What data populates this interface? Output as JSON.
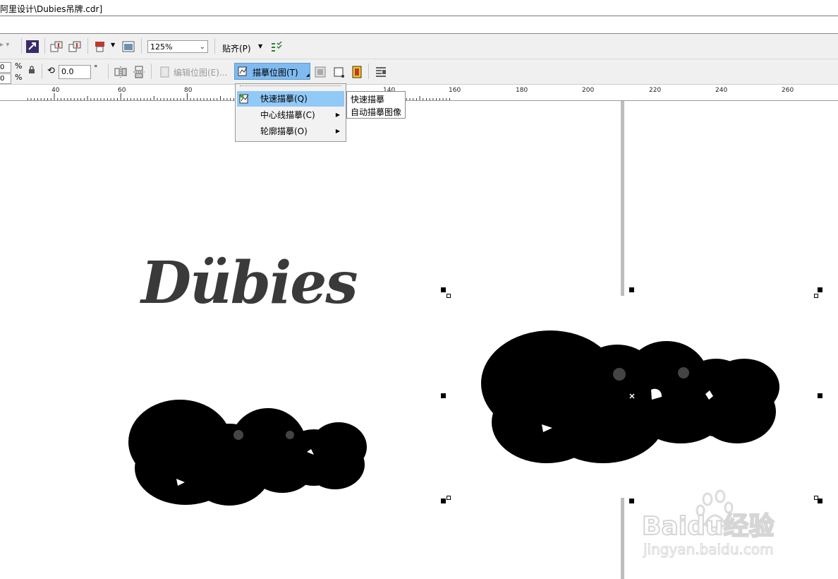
{
  "window": {
    "title": "阿里设计\\Dubies吊牌.cdr]"
  },
  "toolbar": {
    "zoom_value": "125%",
    "snap_label": "贴齐(P)",
    "x_percent_unit": "%",
    "y_percent_unit": "%",
    "x_scale_value": "0",
    "y_scale_value": "0",
    "rotation_value": "0.0",
    "rotation_unit": "°",
    "edit_bitmap_label": "编辑位图(E)...",
    "trace_bitmap_label": "描摹位图(T)"
  },
  "ruler": {
    "labels": [
      "40",
      "60",
      "80",
      "140",
      "160",
      "180",
      "200",
      "220",
      "240",
      "260"
    ]
  },
  "trace_menu": {
    "items": [
      {
        "label": "快速描摹(Q)",
        "has_submenu": false,
        "highlighted": true
      },
      {
        "label": "中心线描摹(C)",
        "has_submenu": true,
        "highlighted": false
      },
      {
        "label": "轮廓描摹(O)",
        "has_submenu": true,
        "highlighted": false
      }
    ]
  },
  "tooltip": {
    "title": "快速描摹",
    "description": "自动描摹图像"
  },
  "canvas": {
    "logo_text": "Dübies",
    "watermark": {
      "brand": "Baidu经验",
      "url": "jingyan.baidu.com"
    }
  },
  "colors": {
    "menu_highlight": "#91c9f7",
    "button_active": "#7fbaf0",
    "logo": "#3a3a3a",
    "blob": "#000000"
  }
}
